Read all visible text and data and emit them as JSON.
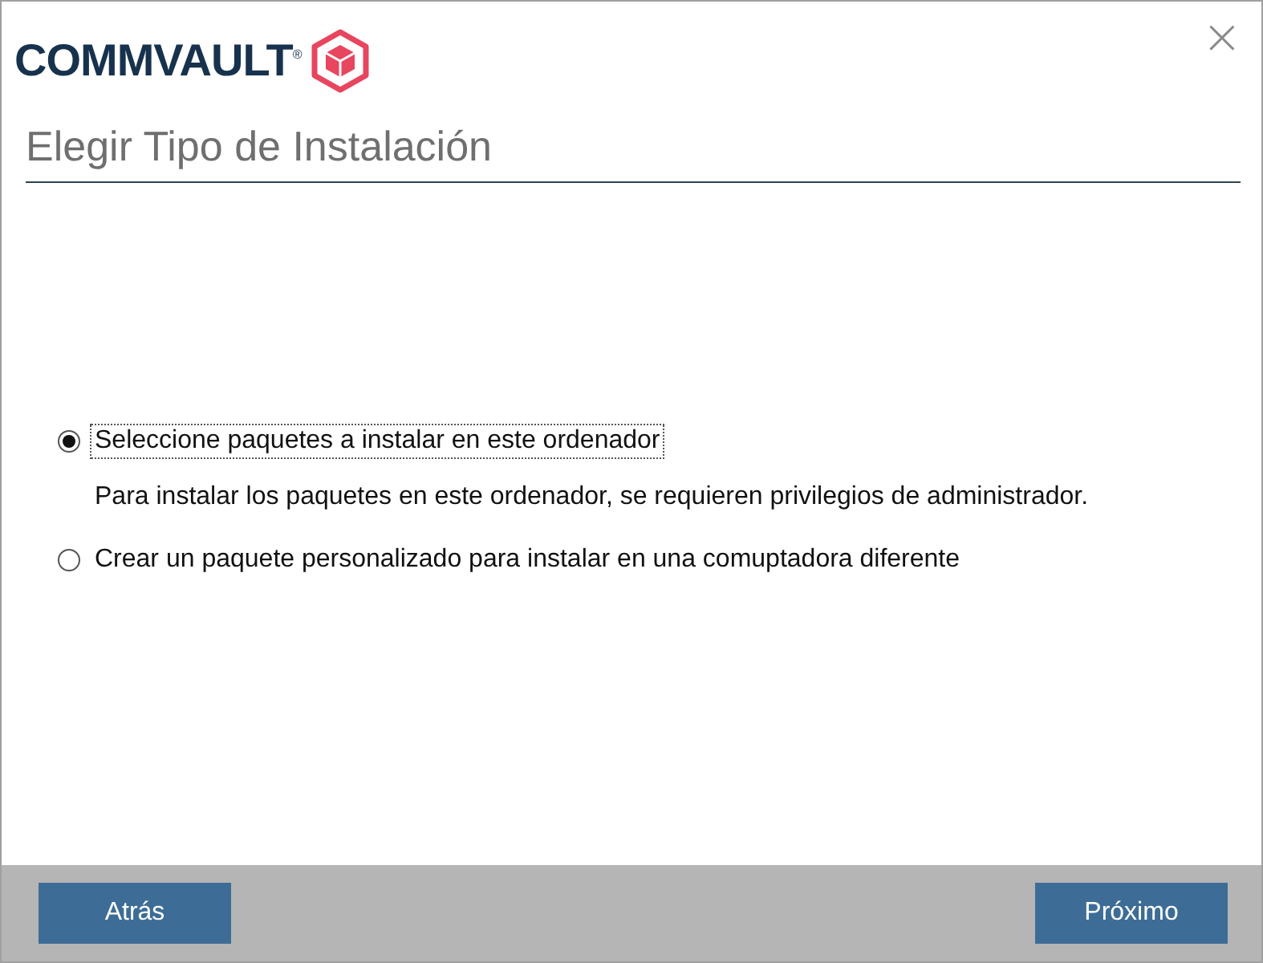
{
  "logo": {
    "text": "COMMVAULT$^{®}$"
  },
  "close": {
    "glyph": "×"
  },
  "title": "Elegir Tipo de Instalación",
  "options": [
    {
      "label": "Seleccione paquetes a instalar en este ordenador",
      "selected": true,
      "focused": true,
      "description": "Para instalar los paquetes en este ordenador, se requieren privilegios de administrador."
    },
    {
      "label": "Crear un paquete personalizado para instalar en una comuptadora diferente",
      "selected": false,
      "focused": false
    }
  ],
  "buttons": {
    "back": "Atrás",
    "next": "Próximo"
  }
}
